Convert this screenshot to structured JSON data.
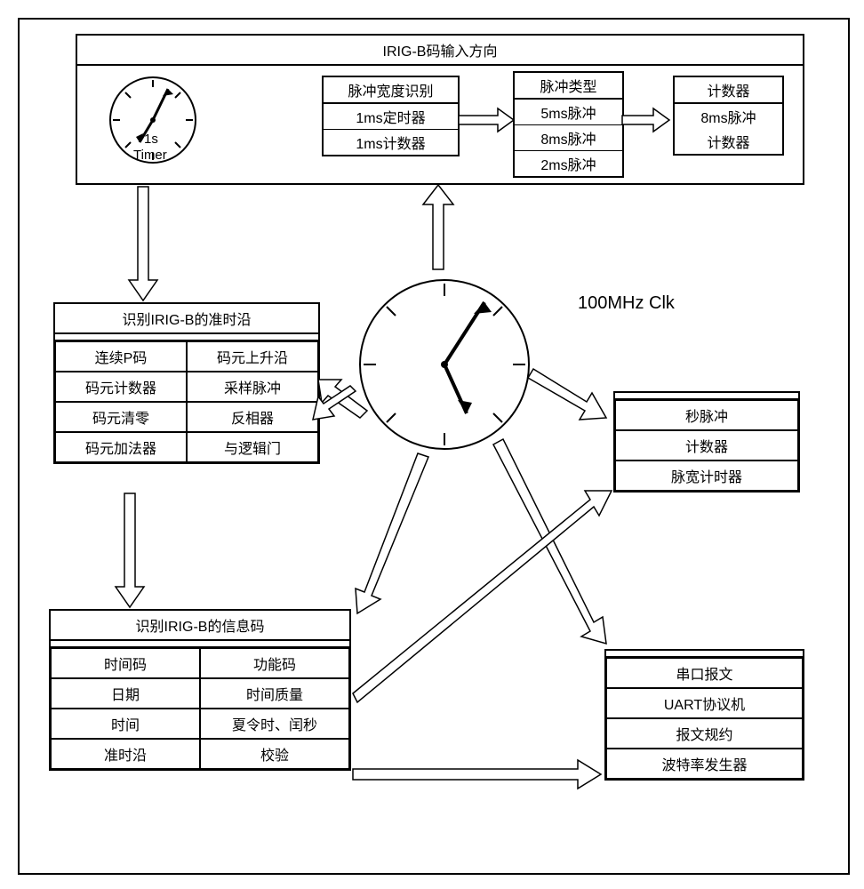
{
  "top_block": {
    "title": "IRIG-B码输入方向",
    "timer_label1": "1s",
    "timer_label2": "Timer",
    "col1": {
      "r1": "脉冲宽度识别",
      "r2": "1ms定时器",
      "r3": "1ms计数器"
    },
    "col2": {
      "header": "脉冲类型",
      "r1": "5ms脉冲",
      "r2": "8ms脉冲",
      "r3": "2ms脉冲"
    },
    "col3": {
      "header": "计数器",
      "r1": "8ms脉冲",
      "r2": "计数器"
    }
  },
  "center_clock_label": "100MHz Clk",
  "block_edge": {
    "title": "识别IRIG-B的准时沿",
    "left": [
      "连续P码",
      "码元计数器",
      "码元清零",
      "码元加法器"
    ],
    "right": [
      "码元上升沿",
      "采样脉冲",
      "反相器",
      "与逻辑门"
    ]
  },
  "block_info": {
    "title": "识别IRIG-B的信息码",
    "left": [
      "时间码",
      "日期",
      "时间",
      "准时沿"
    ],
    "right": [
      "功能码",
      "时间质量",
      "夏令时、闰秒",
      "校验"
    ]
  },
  "block_pulse": {
    "rows": [
      "秒脉冲",
      "计数器",
      "脉宽计时器"
    ]
  },
  "block_uart": {
    "rows": [
      "串口报文",
      "UART协议机",
      "报文规约",
      "波特率发生器"
    ]
  }
}
